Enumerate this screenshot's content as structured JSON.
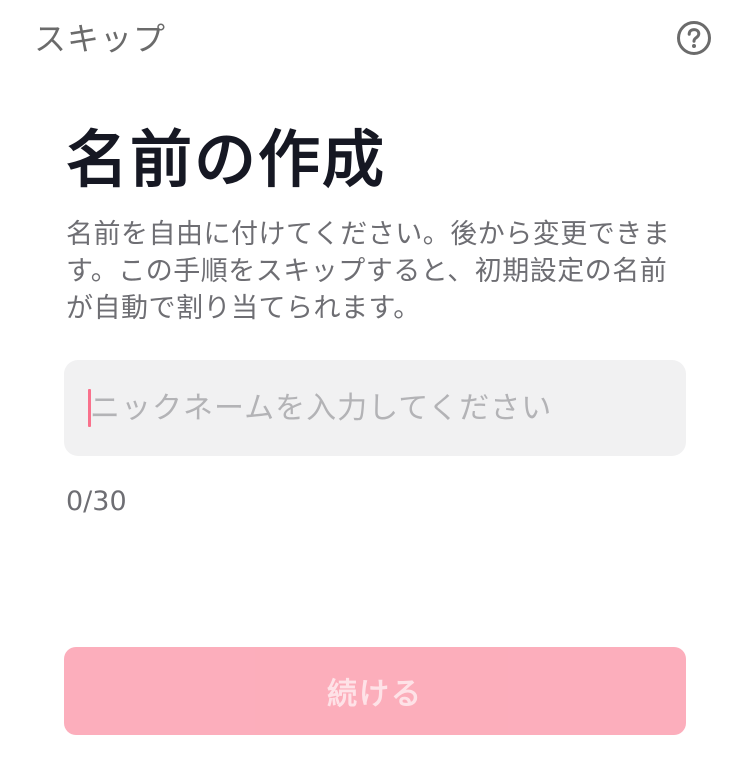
{
  "header": {
    "skip_label": "スキップ",
    "help_icon": "question-circle-icon"
  },
  "main": {
    "title": "名前の作成",
    "description": "名前を自由に付けてください。後から変更できます。この手順をスキップすると、初期設定の名前が自動で割り当てられます。",
    "name_input": {
      "value": "",
      "placeholder": "ニックネームを入力してください"
    },
    "char_count": "0/30",
    "continue_label": "続ける"
  },
  "colors": {
    "title": "#161823",
    "secondary_text": "#6e6e73",
    "input_background": "#f1f1f2",
    "caret": "#fe2c55",
    "button_disabled": "#fcaab8"
  }
}
